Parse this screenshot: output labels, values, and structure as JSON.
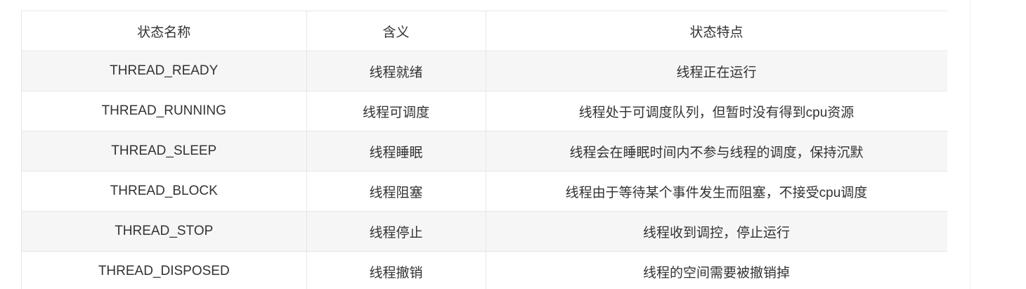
{
  "table": {
    "headers": [
      "状态名称",
      "含义",
      "状态特点"
    ],
    "rows": [
      [
        "THREAD_READY",
        "线程就绪",
        "线程正在运行"
      ],
      [
        "THREAD_RUNNING",
        "线程可调度",
        "线程处于可调度队列，但暂时没有得到cpu资源"
      ],
      [
        "THREAD_SLEEP",
        "线程睡眠",
        "线程会在睡眠时间内不参与线程的调度，保持沉默"
      ],
      [
        "THREAD_BLOCK",
        "线程阻塞",
        "线程由于等待某个事件发生而阻塞，不接受cpu调度"
      ],
      [
        "THREAD_STOP",
        "线程停止",
        "线程收到调控，停止运行"
      ],
      [
        "THREAD_DISPOSED",
        "线程撤销",
        "线程的空间需要被撤销掉"
      ]
    ]
  }
}
